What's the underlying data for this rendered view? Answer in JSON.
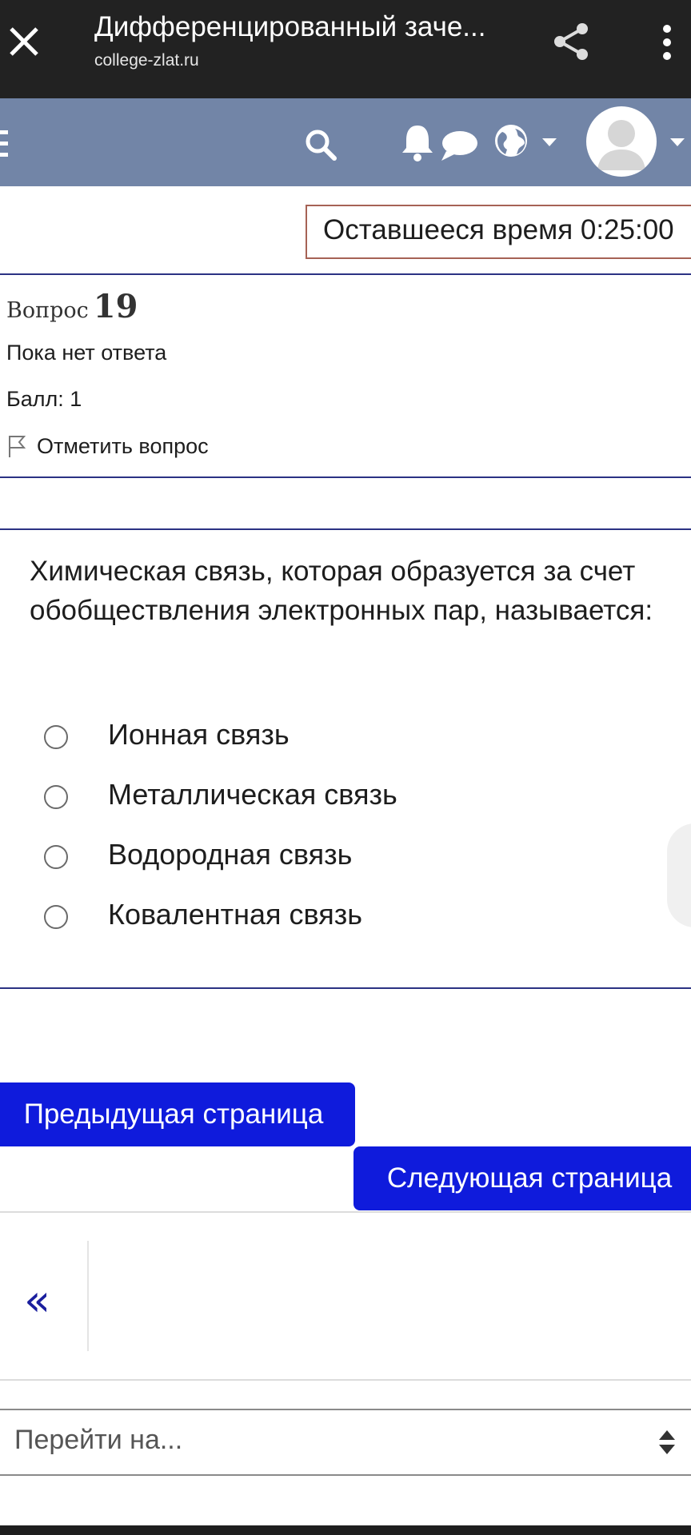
{
  "appbar": {
    "title": "Дифференцированный заче...",
    "url": "college-zlat.ru",
    "bg_color": "#222222"
  },
  "navbar": {
    "bg_color": "#7285a7",
    "icons": [
      "menu-icon",
      "search-icon",
      "bell-icon",
      "chat-icon",
      "globe-icon",
      "avatar"
    ]
  },
  "timer": {
    "label": "Оставшееся время 0:25:00"
  },
  "question": {
    "number_label": "Вопрос",
    "number": "19",
    "state": "Пока нет ответа",
    "grade": "Балл: 1",
    "flag_label": "Отметить вопрос",
    "text": "Химическая связь, которая образуется за счет обобществления электронных пар, называется:",
    "answers": [
      {
        "label": "Ионная связь",
        "selected": false
      },
      {
        "label": "Металлическая связь",
        "selected": false
      },
      {
        "label": "Водородная связь",
        "selected": false
      },
      {
        "label": "Ковалентная связь",
        "selected": false
      }
    ]
  },
  "navigation": {
    "prev_label": "Предыдущая страница",
    "next_label": "Следующая страница",
    "button_color": "#0f1bdc",
    "back_symbol": "«",
    "jump_placeholder": "Перейти на..."
  }
}
